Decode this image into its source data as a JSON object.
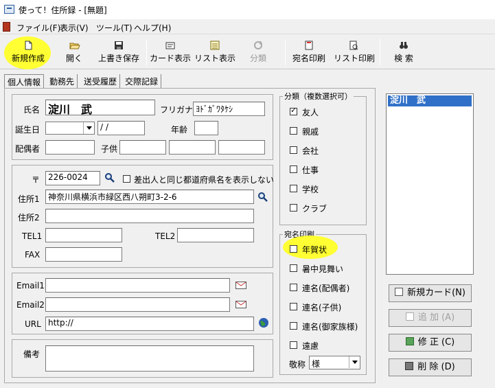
{
  "window": {
    "title": "使って！住所録 - [無題]"
  },
  "menu": [
    {
      "label": "ファイル(F)"
    },
    {
      "label": "表示(V)"
    },
    {
      "label": "ツール(T)"
    },
    {
      "label": "ヘルプ(H)"
    }
  ],
  "toolbar": {
    "new": "新規作成",
    "open": "開く",
    "save": "上書き保存",
    "card_view": "カード表示",
    "list_view": "リスト表示",
    "classify": "分類",
    "address_print": "宛名印刷",
    "list_print": "リスト印刷",
    "search": "検 索"
  },
  "tabs": [
    "個人情報",
    "勤務先",
    "送受履歴",
    "交際記録"
  ],
  "form": {
    "name_label": "氏名",
    "name_value": "淀川　武",
    "furigana_label": "フリガナ",
    "furigana_value": "ﾖﾄﾞｶﾞﾜﾀｹｼ",
    "birthday_label": "誕生日",
    "birthday_date": "/ /",
    "age_label": "年齢",
    "spouse_label": "配偶者",
    "children_label": "子供",
    "postal_symbol": "〒",
    "postal_value": "226-0024",
    "same_pref_label": "差出人と同じ都道府県名を表示しない",
    "address1_label": "住所1",
    "address1_value": "神奈川県横浜市緑区西八朔町3-2-6",
    "address2_label": "住所2",
    "tel1_label": "TEL1",
    "tel2_label": "TEL2",
    "fax_label": "FAX",
    "email1_label": "Email1",
    "email2_label": "Email2",
    "url_label": "URL",
    "url_value": "http://",
    "memo_label": "備考"
  },
  "category": {
    "title": "分類（複数選択可）",
    "items": [
      {
        "label": "友人",
        "checked": true
      },
      {
        "label": "親戚",
        "checked": false
      },
      {
        "label": "会社",
        "checked": false
      },
      {
        "label": "仕事",
        "checked": false
      },
      {
        "label": "学校",
        "checked": false
      },
      {
        "label": "クラブ",
        "checked": false
      }
    ]
  },
  "address_print": {
    "title": "宛名印刷",
    "items": [
      {
        "label": "年賀状",
        "checked": false
      },
      {
        "label": "暑中見舞い",
        "checked": false
      },
      {
        "label": "連名(配偶者)",
        "checked": false
      },
      {
        "label": "連名(子供)",
        "checked": false
      },
      {
        "label": "連名(御家族様)",
        "checked": false
      },
      {
        "label": "遠慮",
        "checked": false
      }
    ],
    "honorific_label": "敬称",
    "honorific_value": "様"
  },
  "list": {
    "selected": "淀川　武"
  },
  "side_buttons": {
    "new_card": "新規カード(N)",
    "add": "追 加 (A)",
    "edit": "修 正 (C)",
    "delete": "削 除 (D)"
  },
  "colors": {
    "highlight": "#ffff33",
    "selection": "#3070c8"
  }
}
